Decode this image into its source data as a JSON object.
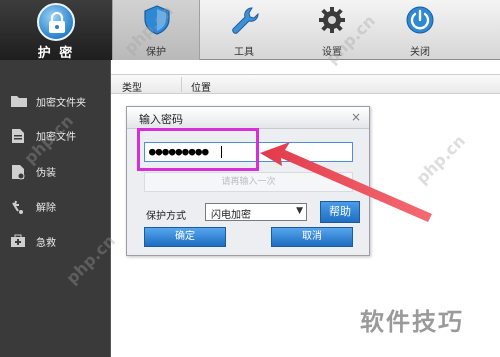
{
  "app": {
    "logo_text": "护 密"
  },
  "tabs": [
    {
      "label": "保护",
      "icon": "shield-icon",
      "active": true
    },
    {
      "label": "工具",
      "icon": "wrench-icon",
      "active": false
    },
    {
      "label": "设置",
      "icon": "gear-icon",
      "active": false
    },
    {
      "label": "关闭",
      "icon": "power-icon",
      "active": false
    }
  ],
  "sidebar": {
    "items": [
      {
        "label": "加密文件夹",
        "icon": "folder-icon"
      },
      {
        "label": "加密文件",
        "icon": "file-icon"
      },
      {
        "label": "伪装",
        "icon": "disguise-icon"
      },
      {
        "label": "解除",
        "icon": "unlock-icon"
      },
      {
        "label": "急救",
        "icon": "firstaid-icon"
      }
    ]
  },
  "list": {
    "col_type": "类型",
    "col_location": "位置"
  },
  "dialog": {
    "title": "输入密码",
    "close": "×",
    "password_value": "●●●●●●●●●",
    "confirm_placeholder": "请再输入一次",
    "mode_label": "保护方式",
    "mode_value": "闪电加密",
    "help_label": "帮助",
    "ok_label": "确定",
    "cancel_label": "取消"
  },
  "annotation": {
    "highlight_color": "#d62fd6",
    "arrow_color": "#e23a4a"
  },
  "watermark": {
    "text": "php.cn",
    "corner": "软件技巧"
  },
  "colors": {
    "sidebar_bg": "#3a3a3a",
    "accent_blue": "#1f6fc2"
  }
}
